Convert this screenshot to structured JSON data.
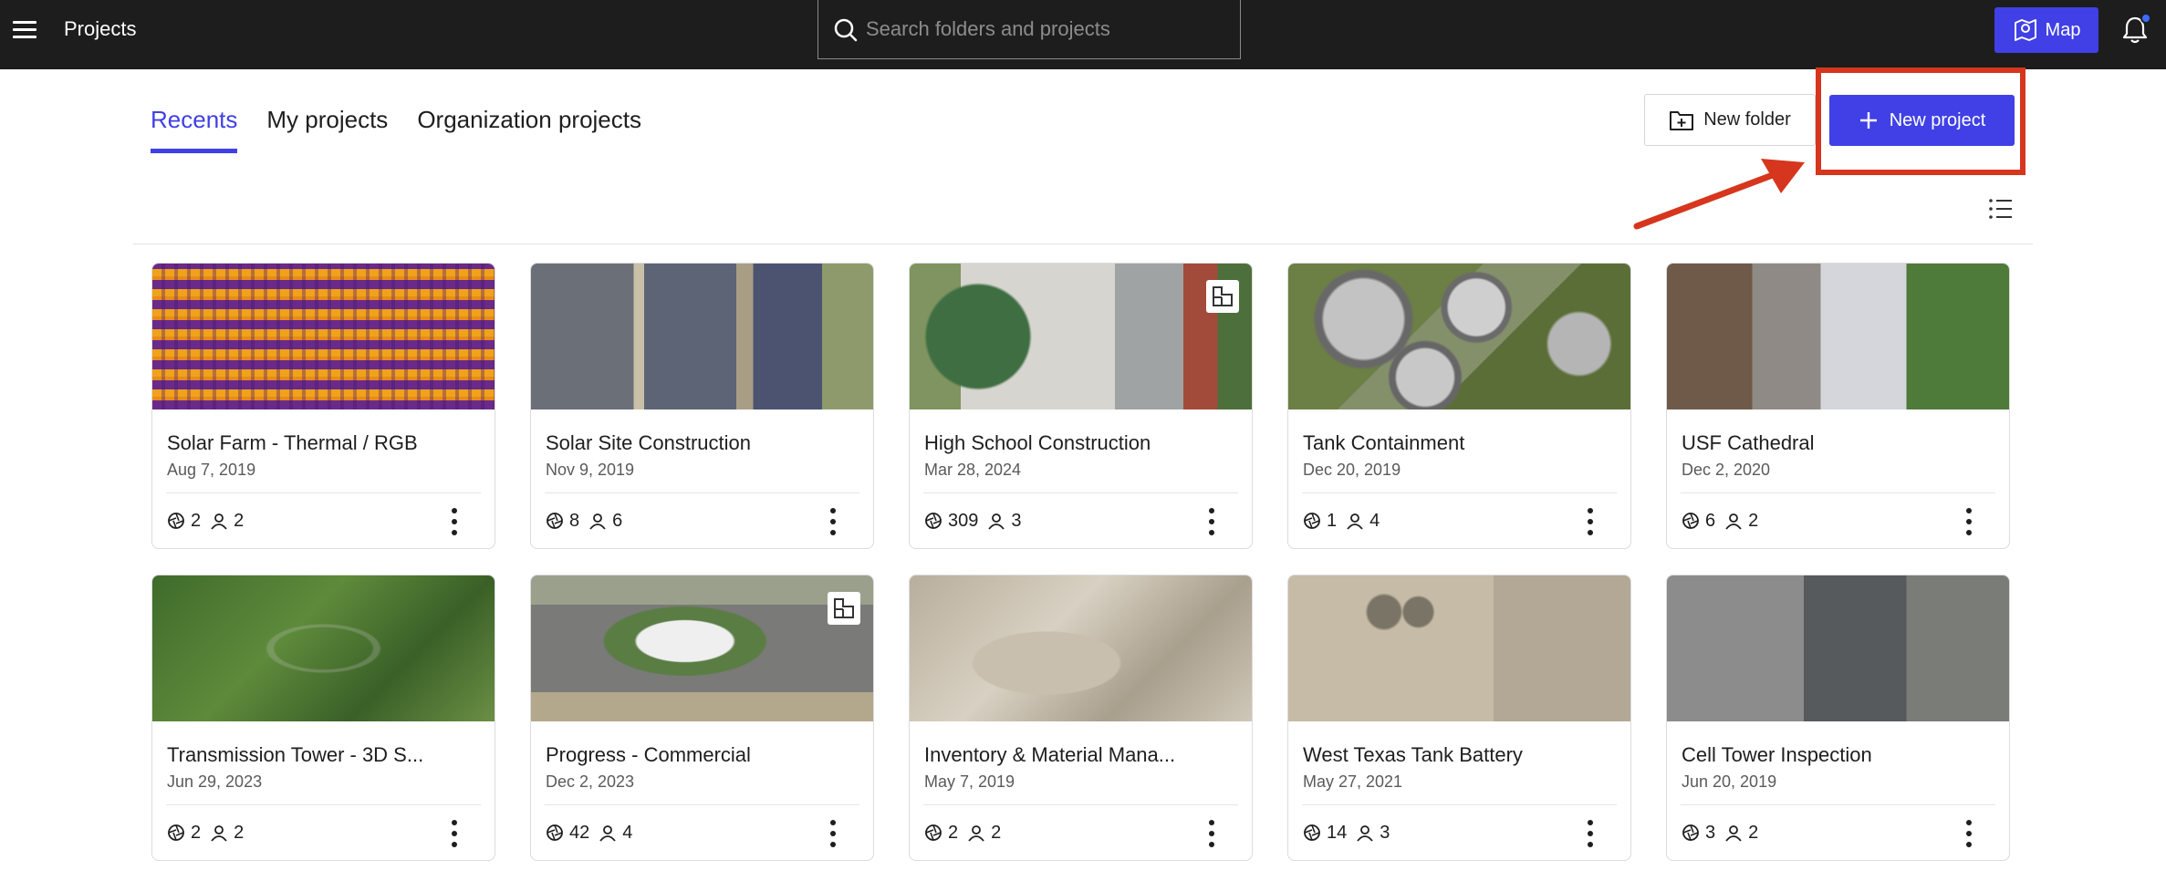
{
  "header": {
    "title": "Projects",
    "search_placeholder": "Search folders and projects",
    "map_label": "Map"
  },
  "tabs": [
    {
      "label": "Recents",
      "active": true
    },
    {
      "label": "My projects",
      "active": false
    },
    {
      "label": "Organization projects",
      "active": false
    }
  ],
  "actions": {
    "new_folder_label": "New folder",
    "new_project_label": "New project"
  },
  "colors": {
    "accent": "#4040e6",
    "highlight": "#d6361d",
    "topbar": "#1d1d1d"
  },
  "projects": [
    {
      "name": "Solar Farm - Thermal / RGB",
      "date": "Aug 7, 2019",
      "maps": "2",
      "members": "2",
      "thumb": "thermal-solar"
    },
    {
      "name": "Solar Site Construction",
      "date": "Nov 9, 2019",
      "maps": "8",
      "members": "6",
      "thumb": "solar-construction"
    },
    {
      "name": "High School Construction",
      "date": "Mar 28, 2024",
      "maps": "309",
      "members": "3",
      "thumb": "school",
      "badge_icon": "plan-icon"
    },
    {
      "name": "Tank Containment",
      "date": "Dec 20, 2019",
      "maps": "1",
      "members": "4",
      "thumb": "tanks"
    },
    {
      "name": "USF Cathedral",
      "date": "Dec 2, 2020",
      "maps": "6",
      "members": "2",
      "thumb": "cathedral"
    },
    {
      "name": "Transmission Tower - 3D S...",
      "date": "Jun 29, 2023",
      "maps": "2",
      "members": "2",
      "thumb": "tower"
    },
    {
      "name": "Progress - Commercial",
      "date": "Dec 2, 2023",
      "maps": "42",
      "members": "4",
      "thumb": "commercial",
      "badge_icon": "plan-icon"
    },
    {
      "name": "Inventory & Material Mana...",
      "date": "May 7, 2019",
      "maps": "2",
      "members": "2",
      "thumb": "quarry"
    },
    {
      "name": "West Texas Tank Battery",
      "date": "May 27, 2021",
      "maps": "14",
      "members": "3",
      "thumb": "tank-battery"
    },
    {
      "name": "Cell Tower Inspection",
      "date": "Jun 20, 2019",
      "maps": "3",
      "members": "2",
      "thumb": "cell-tower"
    }
  ]
}
